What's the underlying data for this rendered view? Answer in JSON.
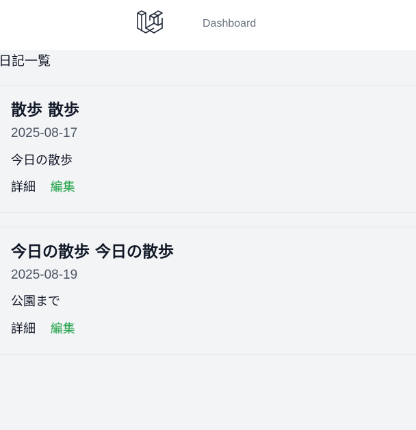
{
  "nav": {
    "logo_icon": "laravel-logo-icon",
    "dashboard_label": "Dashboard"
  },
  "page": {
    "title": "日記一覧"
  },
  "entries": [
    {
      "title": "散歩 散歩",
      "date": "2025-08-17",
      "body": "今日の散歩",
      "detail_label": "詳細",
      "edit_label": "編集"
    },
    {
      "title": "今日の散歩 今日の散歩",
      "date": "2025-08-19",
      "body": "公園まで",
      "detail_label": "詳細",
      "edit_label": "編集"
    }
  ],
  "colors": {
    "background": "#f3f4f6",
    "nav_background": "#ffffff",
    "edit_link": "#22a34a",
    "muted_text": "#6b7280"
  }
}
